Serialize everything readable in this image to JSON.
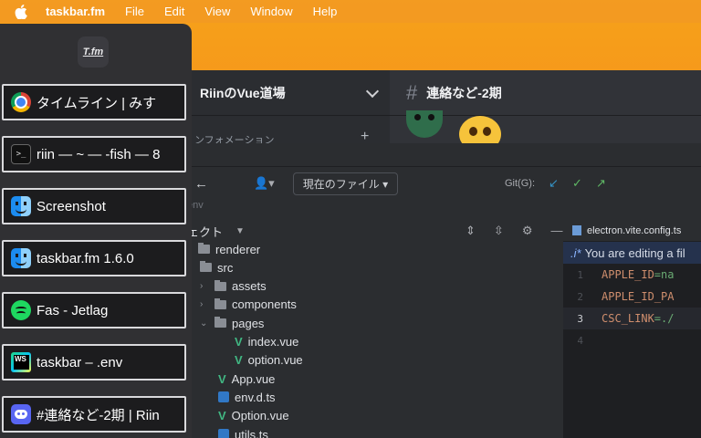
{
  "menubar": {
    "app_name": "taskbar.fm",
    "menus": [
      "File",
      "Edit",
      "View",
      "Window",
      "Help"
    ]
  },
  "discord": {
    "server_name": "RiinのVue道場",
    "channel_name": "連絡など-2期",
    "category": "ンフォメーション",
    "add_symbol": "+"
  },
  "ide": {
    "scope_label": "現在のファイル",
    "git_label": "Git(G):",
    "breadcrumb": "env",
    "project_label": "ェクト",
    "editor_tab": "electron.vite.config.ts",
    "banner_text": "You are editing a fil",
    "code": [
      {
        "num": "1",
        "key": "APPLE_ID",
        "val": "=na"
      },
      {
        "num": "2",
        "key": "APPLE_ID_PA",
        "val": ""
      },
      {
        "num": "3",
        "key": "CSC_LINK",
        "val": "=./"
      },
      {
        "num": "4",
        "key": "",
        "val": ""
      }
    ],
    "tree": [
      {
        "label": "renderer",
        "kind": "folder",
        "caret": ""
      },
      {
        "label": "src",
        "kind": "folder",
        "caret": ""
      },
      {
        "label": "assets",
        "kind": "folder",
        "caret": "›"
      },
      {
        "label": "components",
        "kind": "folder",
        "caret": "›"
      },
      {
        "label": "pages",
        "kind": "folder",
        "caret": "⌄"
      },
      {
        "label": "index.vue",
        "kind": "vue",
        "caret": ""
      },
      {
        "label": "option.vue",
        "kind": "vue",
        "caret": ""
      },
      {
        "label": "App.vue",
        "kind": "vue",
        "caret": ""
      },
      {
        "label": "env.d.ts",
        "kind": "ts",
        "caret": ""
      },
      {
        "label": "Option.vue",
        "kind": "vue",
        "caret": ""
      },
      {
        "label": "utils.ts",
        "kind": "ts",
        "caret": ""
      }
    ]
  },
  "taskbar": {
    "logo_text": "T.fm",
    "items": [
      {
        "label": "タイムライン | みす",
        "icon": "chrome-icon"
      },
      {
        "label": "riin — ~ — -fish — 8",
        "icon": "terminal-icon"
      },
      {
        "label": "Screenshot",
        "icon": "finder-icon"
      },
      {
        "label": "taskbar.fm 1.6.0",
        "icon": "finder-icon"
      },
      {
        "label": "Fas - Jetlag",
        "icon": "spotify-icon"
      },
      {
        "label": "taskbar – .env",
        "icon": "webstorm-icon"
      },
      {
        "label": "#連絡など-2期 | Riin",
        "icon": "discord-icon"
      }
    ]
  },
  "colors": {
    "wallpaper": "#f38b1c",
    "panel": "#303033",
    "task_border": "#d9d9dc"
  }
}
